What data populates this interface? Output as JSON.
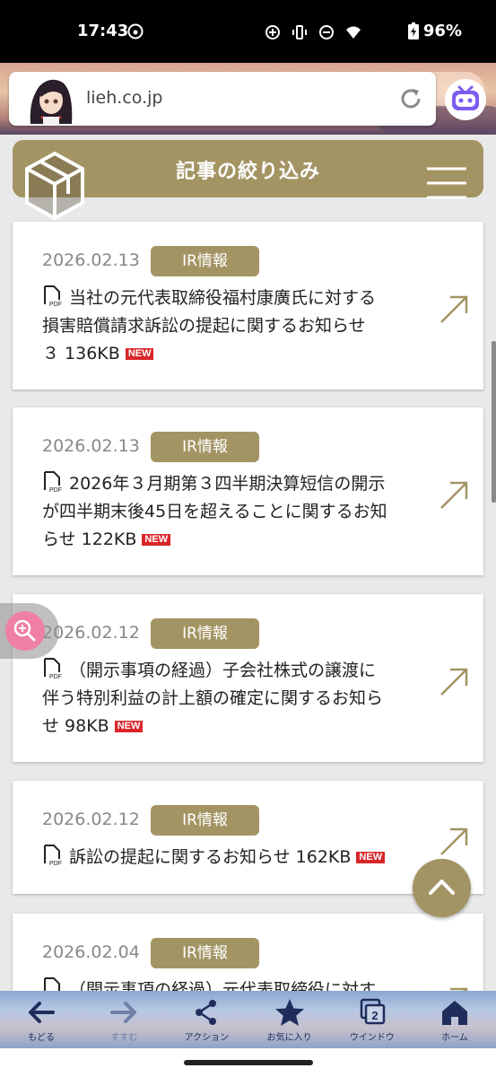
{
  "status_bar": {
    "time": "17:43",
    "battery": "96%",
    "icons": [
      "hotspot-icon",
      "add-circle-icon",
      "vibrate-icon",
      "dnd-icon",
      "wifi-icon",
      "battery-charging-icon"
    ]
  },
  "browser": {
    "url": "lieh.co.jp"
  },
  "filter": {
    "title": "記事の絞り込み"
  },
  "articles": [
    {
      "date": "2026.02.13",
      "tag": "IR情報",
      "lines": [
        "当社の元代表取締役福村康廣氏に対する",
        "損害賠償請求訴訟の提起に関するお知らせ",
        "３ 136KB"
      ],
      "new_label": "NEW"
    },
    {
      "date": "2026.02.13",
      "tag": "IR情報",
      "lines": [
        "2026年３月期第３四半期決算短信の開示",
        "が四半期末後45日を超えることに関するお知",
        "らせ 122KB"
      ],
      "new_label": "NEW"
    },
    {
      "date": "2026.02.12",
      "tag": "IR情報",
      "lines": [
        "（開示事項の経過）子会社株式の譲渡に",
        "伴う特別利益の計上額の確定に関するお知ら",
        "せ 98KB"
      ],
      "new_label": "NEW"
    },
    {
      "date": "2026.02.12",
      "tag": "IR情報",
      "lines": [
        "訴訟の提起に関するお知らせ 162KB"
      ],
      "new_label": "NEW"
    },
    {
      "date": "2026.02.04",
      "tag": "IR情報",
      "lines": [
        "（開示事項の経過）元代表取締役に対す"
      ],
      "new_label": ""
    }
  ],
  "toolbar": {
    "items": [
      {
        "label": "もどる",
        "icon": "back-arrow-icon"
      },
      {
        "label": "すすむ",
        "icon": "forward-arrow-icon"
      },
      {
        "label": "アクション",
        "icon": "share-icon"
      },
      {
        "label": "お気に入り",
        "icon": "star-icon"
      },
      {
        "label": "ウインドウ",
        "icon": "windows-icon",
        "count": "2"
      },
      {
        "label": "ホーム",
        "icon": "home-icon"
      }
    ]
  },
  "colors": {
    "accent": "#a39463",
    "new_badge": "#d9262b",
    "toolbar_text": "#1e2d5b"
  }
}
